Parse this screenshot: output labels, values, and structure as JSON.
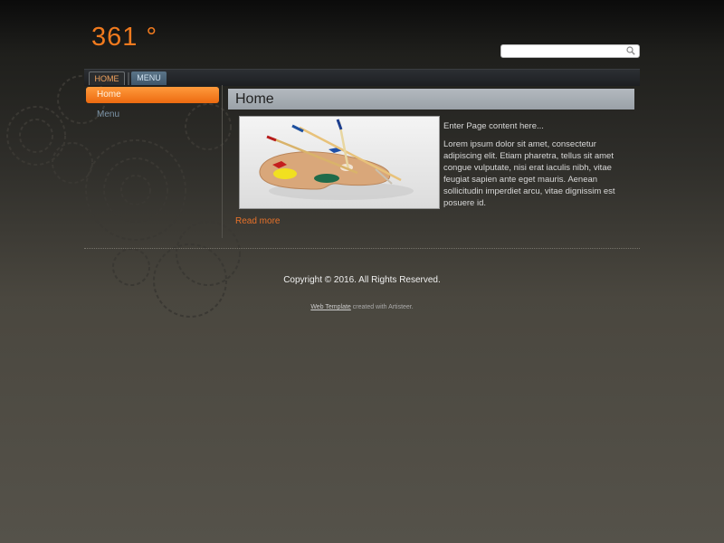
{
  "site": {
    "logo": "361 °"
  },
  "search": {
    "value": "",
    "placeholder": "",
    "icon": "search-icon"
  },
  "nav": {
    "items": [
      {
        "label": "HOME",
        "active": true
      },
      {
        "label": "MENU",
        "active": false
      }
    ]
  },
  "sidebar": {
    "items": [
      {
        "label": "Home",
        "active": true
      },
      {
        "label": "Menu",
        "active": false
      }
    ]
  },
  "main": {
    "title": "Home",
    "intro": "Enter Page content here...",
    "body": "Lorem ipsum dolor sit amet, consectetur adipiscing elit. Etiam pharetra, tellus sit amet congue vulputate, nisi erat iaculis nibh, vitae feugiat sapien ante eget mauris. Aenean sollicitudin imperdiet arcu, vitae dignissim est posuere id.",
    "read_more": "Read more",
    "image": "paint-palette-image"
  },
  "footer": {
    "copyright": "Copyright © 2016. All Rights Reserved.",
    "credit_link": "Web Template",
    "credit_text": "created with Artisteer."
  },
  "colors": {
    "accent": "#f07a1e",
    "nav_active_bg": "#5a7488",
    "title_bar": "#a8aeb4"
  }
}
